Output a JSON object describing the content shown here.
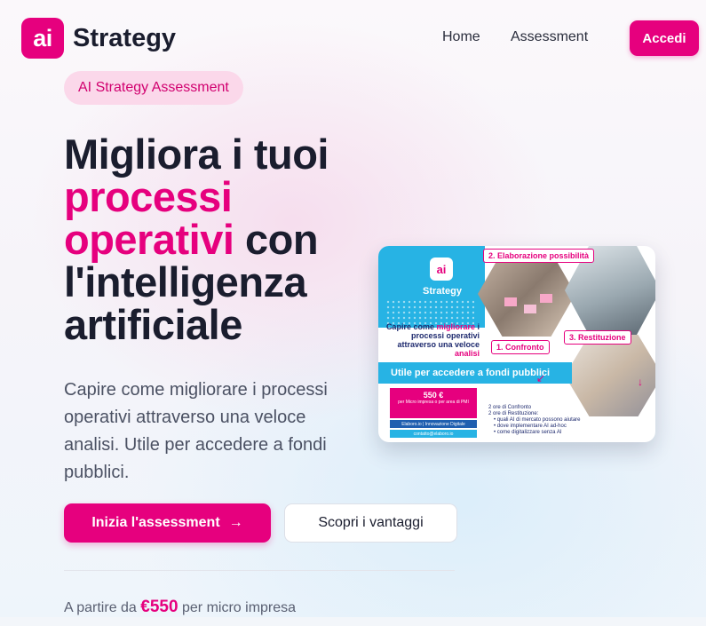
{
  "header": {
    "logo_badge": "ai",
    "logo_text": "Strategy",
    "nav": {
      "home": "Home",
      "assessment": "Assessment"
    },
    "login_label": "Accedi"
  },
  "hero": {
    "pill": "AI Strategy Assessment",
    "title_part1": "Migliora i tuoi ",
    "title_accent": "processi operativi",
    "title_part2": " con l'intelligenza artificiale",
    "description": "Capire come migliorare i processi operativi attraverso una veloce analisi. Utile per accedere a fondi pubblici.",
    "primary_cta": "Inizia l'assessment",
    "primary_cta_icon": "→",
    "secondary_cta": "Scopri i vantaggi",
    "price_prefix": "A partire da ",
    "price": "€550",
    "price_suffix": " per micro impresa"
  },
  "flyer": {
    "logo": "ai",
    "brand": "Strategy",
    "step2": "2. Elaborazione possibilità",
    "step1": "1. Confronto",
    "step3": "3. Restituzione",
    "headline_1": "Capire come ",
    "headline_accent": "migliorare",
    "headline_2": " i processi operativi attraverso una veloce ",
    "headline_accent2": "analisi",
    "band": "Utile per accedere a fondi pubblici",
    "price": "550 €",
    "price_note": "per Micro impresa o per area di PMI",
    "contact1": "Elaboro.io | Innovazione Digitale",
    "contact2": "contatto@elaboro.io",
    "bullets_head1": "2 ore di Confronto",
    "bullets_head2": "2 ore di Restituzione:",
    "bullets": [
      "quali AI di mercato possono aiutare",
      "dove implementare AI ad-hoc",
      "come digitalizzare senza AI"
    ]
  },
  "colors": {
    "brand_pink": "#e6007e",
    "flyer_blue": "#27b3e4",
    "text_dark": "#1a1d2e"
  }
}
